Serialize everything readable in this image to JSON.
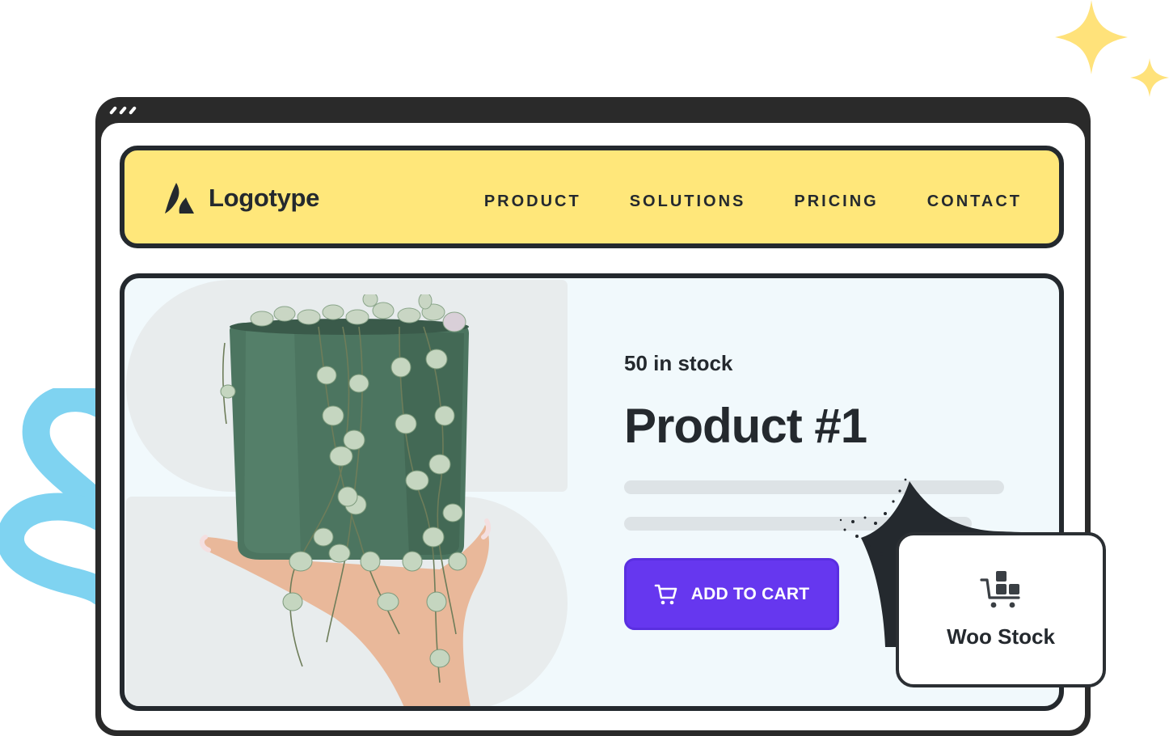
{
  "colors": {
    "navbar_bg": "#ffe77a",
    "frame": "#2a2a2a",
    "text": "#24292e",
    "card_bg": "#f1f9fc",
    "button_bg": "#6637ef",
    "sparkle": "#ffe27a",
    "squiggle": "#7fd3f1"
  },
  "browser": {
    "window_controls": [
      "dot",
      "dot",
      "dot"
    ]
  },
  "navbar": {
    "logo_icon": "logotype-mark-icon",
    "logo_text": "Logotype",
    "links": [
      {
        "label": "PRODUCT"
      },
      {
        "label": "SOLUTIONS"
      },
      {
        "label": "PRICING"
      },
      {
        "label": "CONTACT"
      }
    ]
  },
  "product": {
    "image_alt": "Hand holding a green pot with a string-of-hearts plant",
    "stock_text": "50 in stock",
    "title": "Product #1",
    "add_to_cart": {
      "icon": "cart-icon",
      "label": "ADD TO CART"
    }
  },
  "badge": {
    "icon": "cart-with-boxes-icon",
    "label": "Woo Stock"
  }
}
